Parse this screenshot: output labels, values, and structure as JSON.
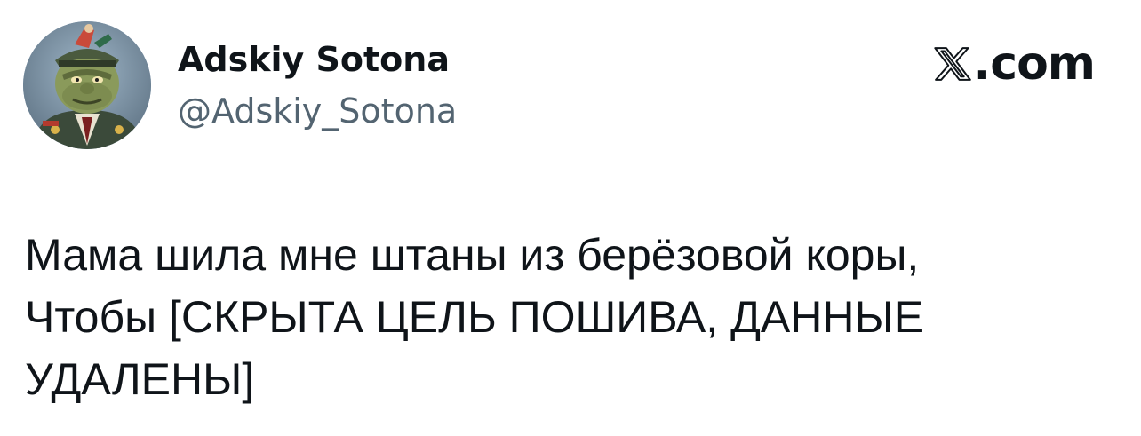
{
  "author": {
    "display_name": "Adskiy Sotona",
    "handle": "@Adskiy_Sotona",
    "avatar_icon": "cartoon-general-avatar"
  },
  "brand": {
    "icon": "x-logo-icon",
    "suffix": ".com"
  },
  "tweet": {
    "lines": [
      "Мама шила мне штаны из берёзовой коры,",
      "Чтобы [СКРЫТА ЦЕЛЬ ПОШИВА, ДАННЫЕ",
      "УДАЛЕНЫ]"
    ]
  },
  "colors": {
    "text_primary": "#0f1419",
    "text_secondary": "#536471",
    "background": "#ffffff"
  }
}
